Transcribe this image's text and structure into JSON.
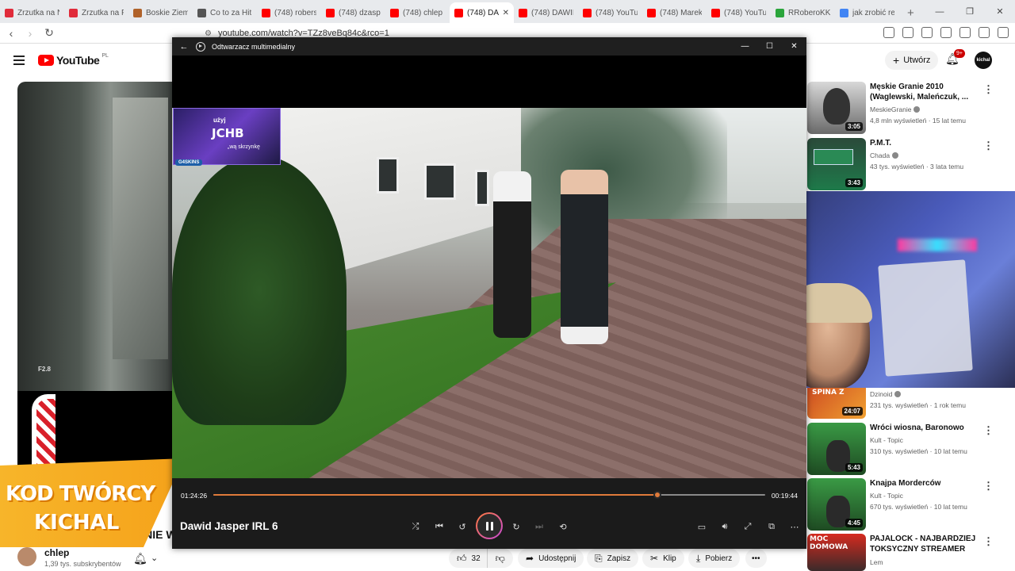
{
  "browser": {
    "tabs": [
      {
        "label": "Zrzutka na N",
        "color": "#e02b3a"
      },
      {
        "label": "Zrzutka na P",
        "color": "#e02b3a"
      },
      {
        "label": "Boskie Ziemi",
        "color": "#b0622a"
      },
      {
        "label": "Co to za Hit",
        "color": "#555555"
      },
      {
        "label": "(748) robersi",
        "color": "#ff0000"
      },
      {
        "label": "(748) dzaspe",
        "color": "#ff0000"
      },
      {
        "label": "(748) chlep",
        "color": "#ff0000"
      },
      {
        "label": "(748) DA",
        "color": "#ff0000",
        "active": true
      },
      {
        "label": "(748) DAWID",
        "color": "#ff0000"
      },
      {
        "label": "(748) YouTub",
        "color": "#ff0000"
      },
      {
        "label": "(748) Marek",
        "color": "#ff0000"
      },
      {
        "label": "(748) YouTub",
        "color": "#ff0000"
      },
      {
        "label": "RRoberoKKT",
        "color": "#2aa53b"
      },
      {
        "label": "jak zrobić rel",
        "color": "#4285f4"
      }
    ],
    "url": "youtube.com/watch?v=TZz8veBq84c&rco=1"
  },
  "youtube": {
    "logo_text": "YouTube",
    "country": "PL",
    "create_label": "Utwórz",
    "notif_count": "9+",
    "avatar_text": "kichal",
    "left_video_label": "F2.8",
    "promo_line1": "KOD TWÓRCY",
    "promo_line2": "KICHAL",
    "title_peek": "ANIE W",
    "channel": {
      "name": "chlep",
      "subs": "1,39 tys. subskrybentów"
    },
    "actions": {
      "likes": "32",
      "share": "Udostępnij",
      "save": "Zapisz",
      "clip": "Klip",
      "download": "Pobierz"
    },
    "recommendations": [
      {
        "title": "Męskie Granie 2010 (Waglewski, Maleńczuk, ...",
        "channel": "MeskieGranie",
        "meta": "4,8 mln wyświetleń · 15 lat temu",
        "duration": "3:05",
        "verified": true
      },
      {
        "title": "P.M.T.",
        "channel": "Chada",
        "meta": "43 tys. wyświetleń · 3 lata temu",
        "duration": "3:43",
        "verified": true
      },
      {
        "title": "",
        "channel": "Dzinoid",
        "meta": "231 tys. wyświetleń · 1 rok temu",
        "duration": "24:07",
        "verified": true,
        "thumb_text": "SPINA Z"
      },
      {
        "title": "Wróci wiosna, Baronowo",
        "channel": "Kult - Topic",
        "meta": "310 tys. wyświetleń · 10 lat temu",
        "duration": "5:43",
        "verified": false
      },
      {
        "title": "Knajpa Morderców",
        "channel": "Kult - Topic",
        "meta": "670 tys. wyświetleń · 10 lat temu",
        "duration": "4:45",
        "verified": false
      },
      {
        "title": "PAJALOCK - NAJBARDZIEJ TOKSYCZNY STREAMER",
        "channel": "Lem",
        "meta": "",
        "duration": "",
        "verified": false,
        "thumb_text": "MOC DOMOWA"
      }
    ]
  },
  "player": {
    "app_title": "Odtwarzacz multimedialny",
    "video_title": "Dawid Jasper IRL 6",
    "time_current": "01:24:26",
    "time_total": "00:19:44",
    "progress_fraction": 0.805,
    "overlay": {
      "line1": "użyj",
      "line2": "JCHB",
      "line3": "„wą skrzynkę",
      "brand": "G4SKINS"
    }
  }
}
